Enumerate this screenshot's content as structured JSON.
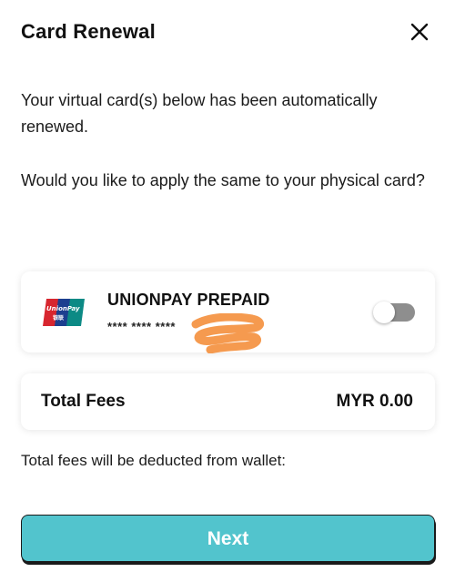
{
  "header": {
    "title": "Card Renewal",
    "close_icon": "close-icon"
  },
  "messages": {
    "renewed": "Your virtual card(s) below has been automatically renewed.",
    "question": "Would you like to apply the same to your physical card?"
  },
  "card": {
    "logo_icon": "unionpay-logo-icon",
    "name": "UNIONPAY PREPAID",
    "masked_number": "**** **** ****",
    "toggle_on": false
  },
  "fees": {
    "label": "Total Fees",
    "value": "MYR 0.00"
  },
  "note": "Total fees will be deducted from wallet:",
  "next_button": {
    "label": "Next"
  },
  "colors": {
    "accent": "#52c4cd",
    "toggle_off": "#8e8e8e",
    "redaction": "#f59a4f"
  }
}
